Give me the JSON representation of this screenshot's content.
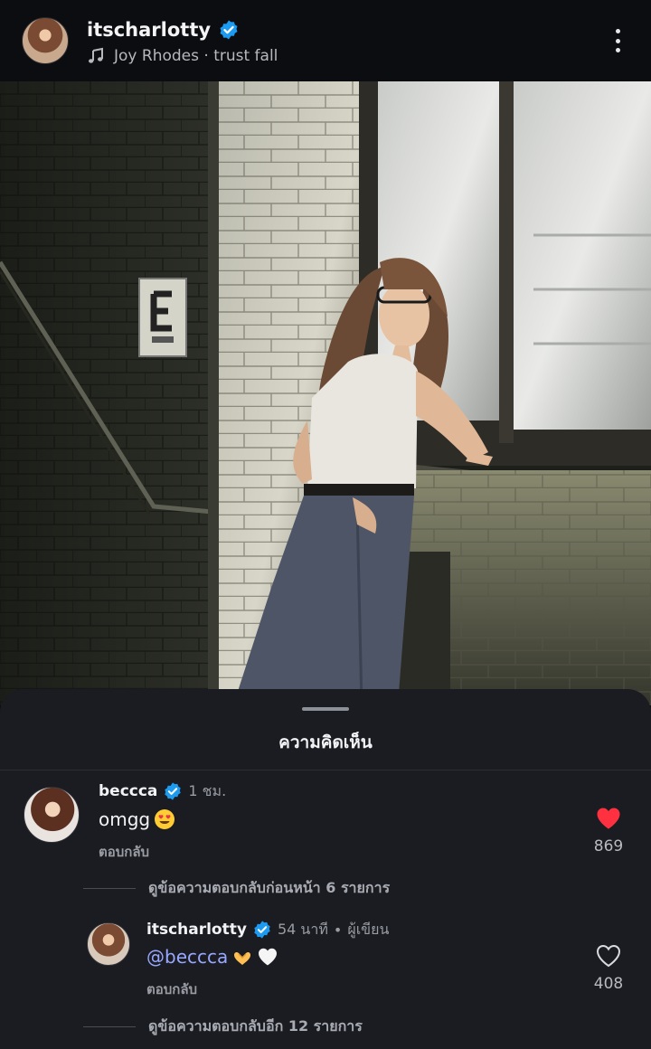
{
  "post": {
    "username": "itscharlotty",
    "music_artist": "Joy Rhodes",
    "music_separator": " · ",
    "music_track": "trust fall"
  },
  "comments_sheet": {
    "title": "ความคิดเห็น",
    "comments": [
      {
        "username": "beccca",
        "time": "1 ชม.",
        "text": "omgg",
        "emoji": "heart-eyes-emoji",
        "reply_label": "ตอบกลับ",
        "likes": "869",
        "liked": true,
        "view_previous_replies": "ดูข้อความตอบกลับก่อนหน้า 6 รายการ"
      },
      {
        "username": "itscharlotty",
        "time": "54 นาที",
        "author_tag": "ผู้เขียน",
        "mention": "@beccca",
        "emoji": [
          "heart-hands-emoji",
          "white-heart-emoji"
        ],
        "reply_label": "ตอบกลับ",
        "likes": "408",
        "liked": false,
        "view_more_replies": "ดูข้อความตอบกลับอีก 12 รายการ"
      }
    ]
  },
  "colors": {
    "verified": "#1d9bf0",
    "like_red": "#ff3040",
    "mention": "#98a8ff",
    "sheet_bg": "#1a1c22"
  }
}
